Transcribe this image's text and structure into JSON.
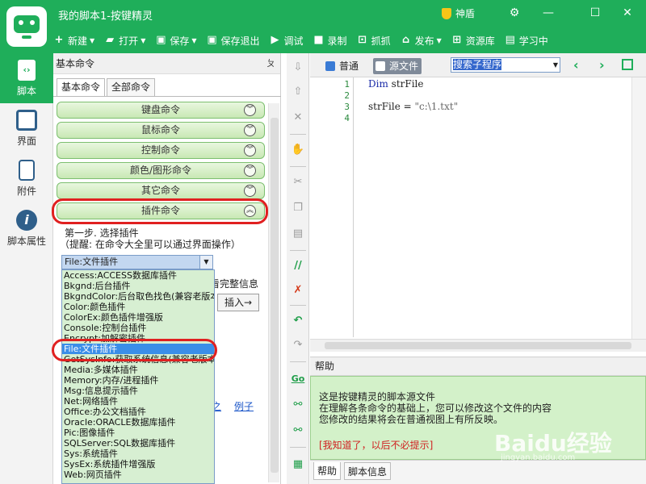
{
  "window": {
    "title": "我的脚本1-按键精灵",
    "shield_label": "神盾"
  },
  "toolbar": {
    "items": [
      {
        "label": "新建",
        "icon": "plus-icon"
      },
      {
        "label": "打开",
        "icon": "folder-icon"
      },
      {
        "label": "保存",
        "icon": "save-icon"
      },
      {
        "label": "保存退出",
        "icon": "save-exit-icon"
      },
      {
        "label": "调试",
        "icon": "play-icon"
      },
      {
        "label": "录制",
        "icon": "record-icon"
      },
      {
        "label": "抓抓",
        "icon": "capture-icon"
      },
      {
        "label": "发布",
        "icon": "publish-icon"
      },
      {
        "label": "资源库",
        "icon": "library-icon"
      },
      {
        "label": "学习中",
        "icon": "learn-icon"
      }
    ]
  },
  "nav": {
    "items": [
      {
        "label": "脚本",
        "active": true
      },
      {
        "label": "界面",
        "active": false
      },
      {
        "label": "附件",
        "active": false
      },
      {
        "label": "脚本属性",
        "active": false
      }
    ]
  },
  "panel": {
    "title": "基本命令",
    "pin": "ㄆ",
    "tabs": [
      "基本命令",
      "全部命令"
    ],
    "categories": [
      "键盘命令",
      "鼠标命令",
      "控制命令",
      "颜色/图形命令",
      "其它命令",
      "插件命令"
    ],
    "step_title": "第一步. 选择插件",
    "step_hint": "（提醒: 在命令大全里可以通过界面操作）",
    "selected_plugin": "File:文件插件",
    "behind_text": "看完整信息",
    "insert_button": "插入→",
    "link_partial": "之",
    "link_example": "例子",
    "dropdown_options": [
      "Access:ACCESS数据库插件",
      "Bkgnd:后台插件",
      "BkgndColor:后台取色找色(兼容老版本)",
      "Color:颜色插件",
      "ColorEx:颜色插件增强版",
      "Console:控制台插件",
      "Encrypt:加解密插件",
      "File:文件插件",
      "GetSysInfo:获取系统信息(兼容老版本)",
      "Media:多媒体插件",
      "Memory:内存/进程插件",
      "Msg:信息提示插件",
      "Net:网络插件",
      "Office:办公文档插件",
      "Oracle:ORACLE数据库插件",
      "Pic:图像插件",
      "SQLServer:SQL数据库插件",
      "Sys:系统插件",
      "SysEx:系统插件增强版",
      "Web:网页插件"
    ],
    "selected_index": 7
  },
  "editor": {
    "mode_normal": "普通",
    "mode_source": "源文件",
    "search_placeholder": "搜索子程序",
    "lines": [
      "1",
      "2",
      "3",
      "4"
    ],
    "code": {
      "l1_kw": "Dim",
      "l1_rest": " strFile",
      "l3_left": "strFile = ",
      "l3_str": "\"c:\\1.txt\""
    }
  },
  "help": {
    "title": "帮助",
    "lines": [
      "这是按键精灵的脚本源文件",
      "在理解各条命令的基础上，您可以修改这个文件的内容",
      "您修改的结果将会在普通视图上有所反映。"
    ],
    "dismiss": "[我知道了，以后不必提示]",
    "tabs": [
      "帮助",
      "脚本信息"
    ]
  },
  "watermark": {
    "brand": "Baidu经验",
    "url": "jingyan.baidu.com"
  },
  "colors": {
    "accent": "#1fae5a",
    "help_bg": "#d3f1c9",
    "highlight_red": "#e02020"
  }
}
